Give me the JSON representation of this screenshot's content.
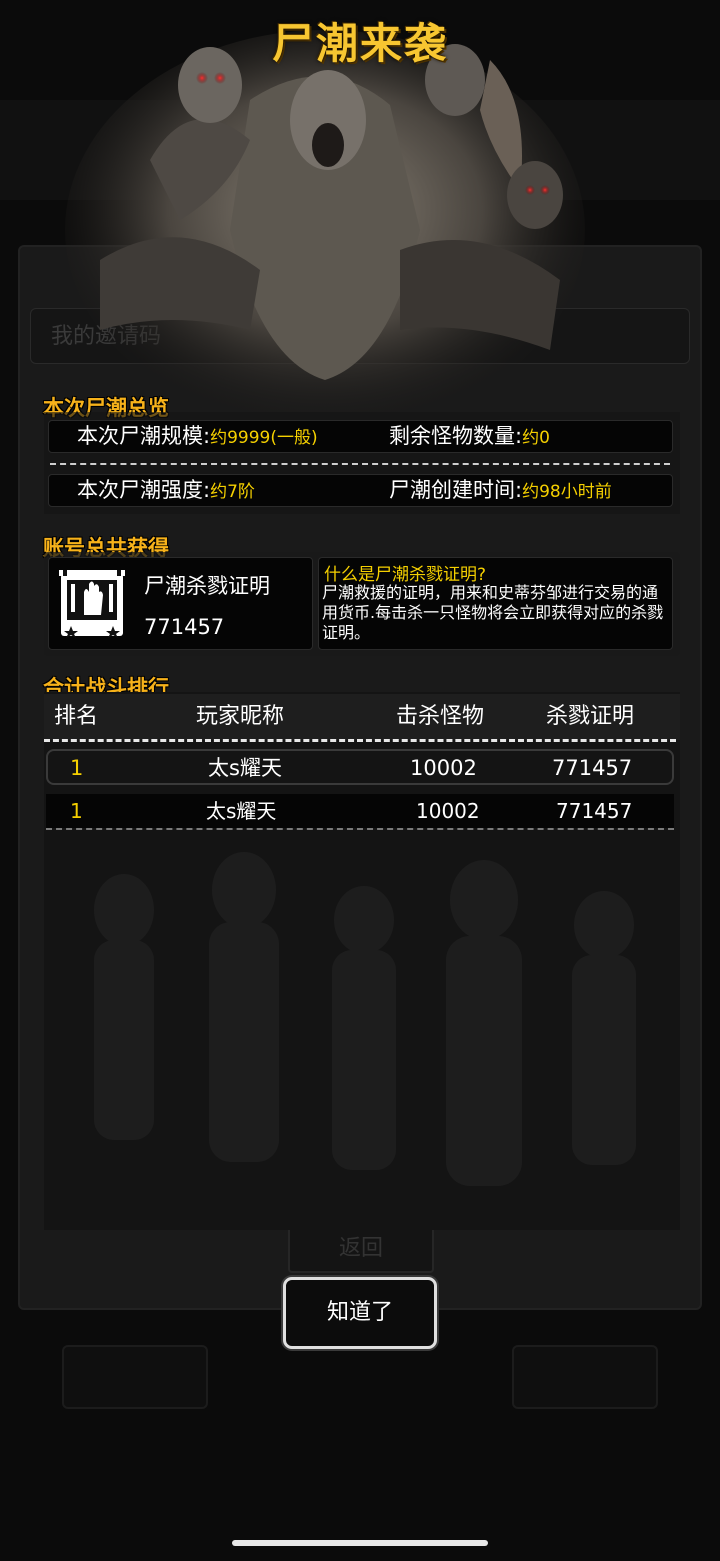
{
  "background": {
    "invite_placeholder": "我的邀请码",
    "return_label": "返回",
    "bottom_left_label": "",
    "bottom_right_label": ""
  },
  "modal": {
    "title": "尸潮来袭",
    "overview": {
      "section_title": "本次尸潮总览",
      "scale_label": "本次尸潮规模:",
      "scale_value": "约9999(一般)",
      "remaining_label": "剩余怪物数量:",
      "remaining_value": "约0",
      "strength_label": "本次尸潮强度:",
      "strength_value": "约7阶",
      "created_label": "尸潮创建时间:",
      "created_value": "约98小时前"
    },
    "account": {
      "section_title": "账号总共获得",
      "cert_name": "尸潮杀戮证明",
      "cert_count": "771457",
      "info_question": "什么是尸潮杀戮证明?",
      "info_desc": "尸潮救援的证明，用来和史蒂芬邹进行交易的通用货币.每击杀一只怪物将会立即获得对应的杀戮证明。"
    },
    "ranking": {
      "section_title": "合计战斗排行",
      "headers": [
        "排名",
        "玩家昵称",
        "击杀怪物",
        "杀戮证明"
      ],
      "self_row": {
        "rank": "1",
        "name": "太s耀天",
        "kills": "10002",
        "certs": "771457"
      },
      "rows": [
        {
          "rank": "1",
          "name": "太s耀天",
          "kills": "10002",
          "certs": "771457"
        }
      ]
    },
    "ok_label": "知道了"
  },
  "colors": {
    "title_gold": "#f7c631",
    "section_orange": "#f7b21a",
    "value_yellow": "#f5d000"
  }
}
